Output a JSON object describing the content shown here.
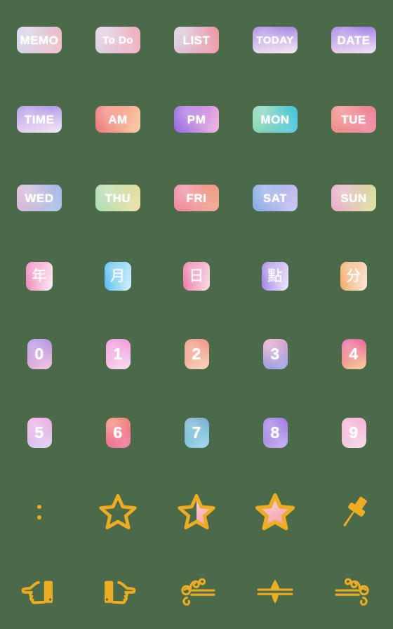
{
  "background_color": "#4a6a4a",
  "gold_color": "#eead21",
  "sheet": {
    "columns": 5,
    "rows": 8,
    "rows_data": [
      {
        "row_name": "labels-planner",
        "items": [
          {
            "name": "memo",
            "type": "label-tile",
            "text": "MEMO",
            "grad_from": "#cfd6ef",
            "grad_to": "#f0b9c0",
            "angle": 100
          },
          {
            "name": "todo",
            "type": "label-tile",
            "text": "To Do",
            "grad_from": "#dcd3ea",
            "grad_to": "#f1a9b6",
            "angle": 100
          },
          {
            "name": "list",
            "type": "label-tile",
            "text": "LIST",
            "grad_from": "#d6cfe6",
            "grad_to": "#ef8e9c",
            "angle": 105
          },
          {
            "name": "today",
            "type": "label-tile",
            "text": "TODAY",
            "grad_from": "#9c7ede",
            "grad_to": "#f5e6f1",
            "angle": 175
          },
          {
            "name": "date",
            "type": "label-tile",
            "text": "DATE",
            "grad_from": "#9b76e2",
            "grad_to": "#f2ddf0",
            "angle": 175
          }
        ]
      },
      {
        "row_name": "labels-time",
        "items": [
          {
            "name": "time",
            "type": "label-tile",
            "text": "TIME",
            "grad_from": "#a88ae4",
            "grad_to": "#f3e4f3",
            "angle": 170
          },
          {
            "name": "am",
            "type": "label-tile",
            "text": "AM",
            "grad_from": "#ee6f73",
            "grad_to": "#f9c49a",
            "angle": 95
          },
          {
            "name": "pm",
            "type": "label-tile",
            "text": "PM",
            "grad_from": "#8f5fe0",
            "grad_to": "#efa8dd",
            "angle": 95
          },
          {
            "name": "mon",
            "type": "label-tile",
            "text": "MON",
            "grad_from": "#8fd8ae",
            "grad_to": "#41c3dd",
            "angle": 95
          },
          {
            "name": "tue",
            "type": "label-tile",
            "text": "TUE",
            "grad_from": "#f08a80",
            "grad_to": "#ef7f9d",
            "angle": 95
          }
        ]
      },
      {
        "row_name": "labels-weekdays",
        "items": [
          {
            "name": "wed",
            "type": "label-tile",
            "text": "WED",
            "grad_from": "#dcb6d4",
            "grad_to": "#9fbbe8",
            "angle": 95
          },
          {
            "name": "thu",
            "type": "label-tile",
            "text": "THU",
            "grad_from": "#a8dcb0",
            "grad_to": "#ecdf9b",
            "angle": 95
          },
          {
            "name": "fri",
            "type": "label-tile",
            "text": "FRI",
            "grad_from": "#f082a4",
            "grad_to": "#f0a07f",
            "angle": 95
          },
          {
            "name": "sat",
            "type": "label-tile",
            "text": "SAT",
            "grad_from": "#7fa8e2",
            "grad_to": "#c7bdf0",
            "angle": 95
          },
          {
            "name": "sun",
            "type": "label-tile",
            "text": "SUN",
            "grad_from": "#e9a8cd",
            "grad_to": "#d9df96",
            "angle": 95
          }
        ]
      },
      {
        "row_name": "cjk-date-units",
        "items": [
          {
            "name": "year-char",
            "type": "square-tile",
            "text": "年",
            "grad_from": "#f07ab4",
            "grad_to": "#fbeaf2",
            "angle": 100
          },
          {
            "name": "month-char",
            "type": "square-tile",
            "text": "月",
            "grad_from": "#46b8ef",
            "grad_to": "#cfeffb",
            "angle": 100
          },
          {
            "name": "day-char",
            "type": "square-tile",
            "text": "日",
            "grad_from": "#ef6ea0",
            "grad_to": "#f8d9e2",
            "angle": 100
          },
          {
            "name": "hour-char",
            "type": "square-tile",
            "text": "點",
            "grad_from": "#9b79e6",
            "grad_to": "#ece4fa",
            "angle": 100
          },
          {
            "name": "minute-char",
            "type": "square-tile",
            "text": "分",
            "grad_from": "#f5a35e",
            "grad_to": "#fbe5d2",
            "angle": 100
          }
        ]
      },
      {
        "row_name": "digits-0-4",
        "items": [
          {
            "name": "digit-0",
            "type": "digit-tile",
            "text": "0",
            "grad_from": "#a78ce4",
            "grad_to": "#f3b9d8",
            "angle": 165
          },
          {
            "name": "digit-1",
            "type": "digit-tile",
            "text": "1",
            "grad_from": "#f08ada",
            "grad_to": "#f7d7ee",
            "angle": 165
          },
          {
            "name": "digit-2",
            "type": "digit-tile",
            "text": "2",
            "grad_from": "#ef8a76",
            "grad_to": "#f7cdb4",
            "angle": 165
          },
          {
            "name": "digit-3",
            "type": "digit-tile",
            "text": "3",
            "grad_from": "#efa5c6",
            "grad_to": "#8fa0e6",
            "angle": 165
          },
          {
            "name": "digit-4",
            "type": "digit-tile",
            "text": "4",
            "grad_from": "#e8559d",
            "grad_to": "#f7c38c",
            "angle": 165
          }
        ]
      },
      {
        "row_name": "digits-5-9",
        "items": [
          {
            "name": "digit-5",
            "type": "digit-tile",
            "text": "5",
            "grad_from": "#f0a5e0",
            "grad_to": "#d8cdf2",
            "angle": 165
          },
          {
            "name": "digit-6",
            "type": "digit-tile",
            "text": "6",
            "grad_from": "#f2846e",
            "grad_to": "#ee6f9e",
            "angle": 165
          },
          {
            "name": "digit-7",
            "type": "digit-tile",
            "text": "7",
            "grad_from": "#6fa8c8",
            "grad_to": "#8fd4ea",
            "angle": 165
          },
          {
            "name": "digit-8",
            "type": "digit-tile",
            "text": "8",
            "grad_from": "#9b73e4",
            "grad_to": "#b9a3ee",
            "angle": 165
          },
          {
            "name": "digit-9",
            "type": "digit-tile",
            "text": "9",
            "grad_from": "#f5aad0",
            "grad_to": "#f6d4e6",
            "angle": 165
          }
        ]
      },
      {
        "row_name": "stars-and-pin",
        "items": [
          {
            "name": "colon",
            "type": "colon-icon",
            "text": ":"
          },
          {
            "name": "star-empty",
            "type": "star-empty-icon",
            "text": ""
          },
          {
            "name": "star-half",
            "type": "star-half-icon",
            "text": ""
          },
          {
            "name": "star-full",
            "type": "star-full-icon",
            "text": ""
          },
          {
            "name": "pushpin",
            "type": "pushpin-icon",
            "text": ""
          }
        ]
      },
      {
        "row_name": "hands-and-dividers",
        "items": [
          {
            "name": "hand-pointing-left",
            "type": "hand-left-icon",
            "text": ""
          },
          {
            "name": "hand-pointing-right",
            "type": "hand-right-icon",
            "text": ""
          },
          {
            "name": "divider-flourish-left",
            "type": "divider-left-icon",
            "text": ""
          },
          {
            "name": "divider-center",
            "type": "divider-center-icon",
            "text": ""
          },
          {
            "name": "divider-flourish-right",
            "type": "divider-right-icon",
            "text": ""
          }
        ]
      }
    ]
  }
}
